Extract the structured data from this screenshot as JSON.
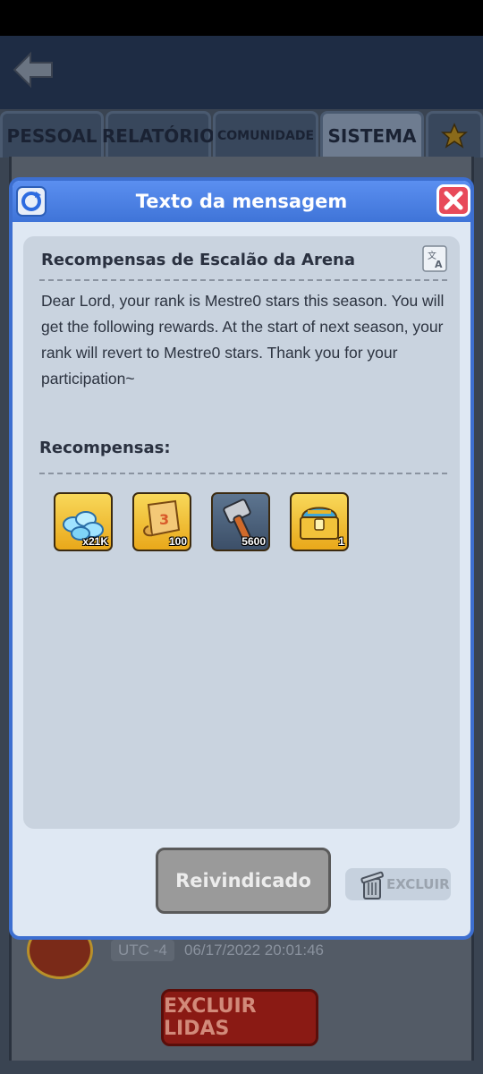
{
  "tabs": [
    {
      "label": "PESSOAL"
    },
    {
      "label": "RELATÓRIO"
    },
    {
      "label": "COMUNIDADE"
    },
    {
      "label": "SISTEMA",
      "active": true
    },
    {
      "icon": "star-icon"
    }
  ],
  "list": {
    "utc": "UTC -4",
    "timestamp": "06/17/2022 20:01:46",
    "delete_read_label": "EXCLUIR LIDAS"
  },
  "modal": {
    "title": "Texto da mensagem",
    "subject": "Recompensas de Escalão da Arena",
    "body": "Dear Lord, your rank is Mestre0 stars this season. You will get the following rewards. At the start of next season, your rank will revert to Mestre0 stars. Thank you for your participation~",
    "rewards_title": "Recompensas:",
    "rewards": [
      {
        "icon": "diamonds-icon",
        "count": "x21K",
        "style": "gold"
      },
      {
        "icon": "scroll-icon",
        "count": "100",
        "style": "gold"
      },
      {
        "icon": "hammer-icon",
        "count": "5600",
        "style": "blue"
      },
      {
        "icon": "treasure-chest-icon",
        "count": "1",
        "style": "gold"
      }
    ],
    "claimed_label": "Reivindicado",
    "delete_label": "EXCLUIR"
  },
  "colors": {
    "modal_header": "#3f74d8",
    "modal_bg": "#dfe8f3",
    "close_button": "#e84a5a",
    "delete_read_button": "#8a1a14"
  }
}
